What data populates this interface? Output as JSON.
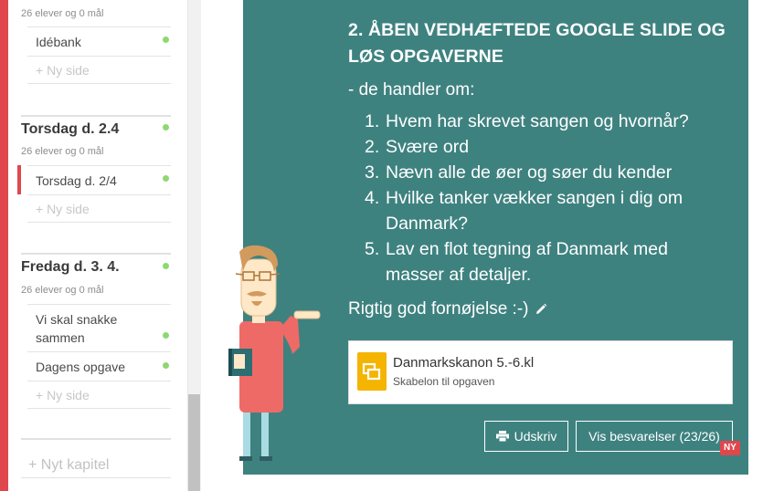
{
  "sidebar": {
    "top_meta": "26 elever og 0 mål",
    "top_items": [
      {
        "label": "Idébank"
      },
      {
        "label": "+ Ny side"
      }
    ],
    "days": [
      {
        "title": "Torsdag d. 2.4",
        "meta": "26 elever og 0 mål",
        "items": [
          {
            "label": "Torsdag d. 2/4",
            "active": true
          },
          {
            "label": "+ Ny side"
          }
        ]
      },
      {
        "title": "Fredag d. 3. 4.",
        "meta": "26 elever og 0 mål",
        "items": [
          {
            "label": "Vi skal snakke sammen"
          },
          {
            "label": "Dagens opgave"
          },
          {
            "label": "+ Ny side"
          }
        ]
      }
    ],
    "new_chapter": "+ Nyt kapitel"
  },
  "main": {
    "title": "2. ÅBEN VEDHÆFTEDE GOOGLE SLIDE OG LØS OPGAVERNE",
    "subtitle": "- de handler om:",
    "tasks": [
      {
        "num": "1.",
        "text": "Hvem har skrevet sangen og hvornår?"
      },
      {
        "num": "2.",
        "text": "Svære ord"
      },
      {
        "num": "3.",
        "text": "Nævn alle de øer og søer du kender"
      },
      {
        "num": "4.",
        "text": "Hvilke tanker vækker sangen i dig om Danmark?"
      },
      {
        "num": "5.",
        "text": "Lav en flot tegning af Danmark med masser af detaljer."
      }
    ],
    "closing": "Rigtig god fornøjelse :-)",
    "attachment": {
      "name": "Danmarkskanon 5.-6.kl",
      "description": "Skabelon til opgaven",
      "icon": "google-slides-icon"
    },
    "buttons": {
      "print": "Udskriv",
      "answers": "Vis besvarelser (23/26)",
      "new_badge": "NY"
    }
  },
  "colors": {
    "card_bg": "#3e8280",
    "accent_red": "#e0474c",
    "status_dot": "#8ed96f",
    "slides_yellow": "#f4b400"
  }
}
